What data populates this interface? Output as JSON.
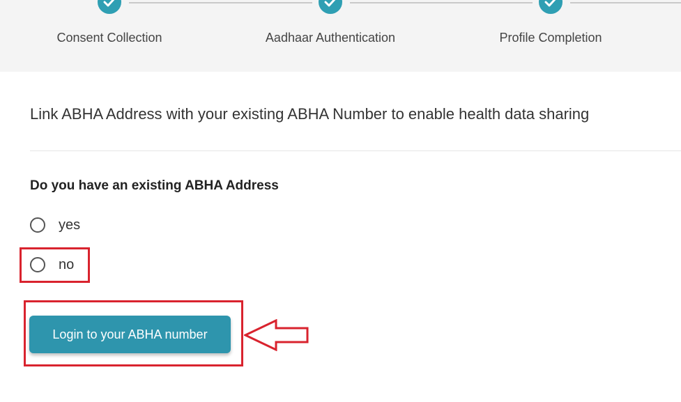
{
  "stepper": {
    "steps": [
      {
        "label": "Consent Collection",
        "status": "completed"
      },
      {
        "label": "Aadhaar Authentication",
        "status": "completed"
      },
      {
        "label": "Profile Completion",
        "status": "completed"
      }
    ]
  },
  "content": {
    "intro": "Link ABHA Address with your existing ABHA Number to enable health data sharing",
    "question": "Do you have an existing ABHA Address",
    "options": [
      {
        "label": "yes",
        "selected": false
      },
      {
        "label": "no",
        "selected": false
      }
    ],
    "login_button_label": "Login to your ABHA number"
  },
  "colors": {
    "accent": "#2e95ad",
    "step_complete": "#2f9fb3",
    "annotation_red": "#d9232e",
    "header_bg": "#f4f4f4"
  },
  "icons": {
    "step_complete": "check-icon",
    "annotation": "arrow-left-icon"
  }
}
